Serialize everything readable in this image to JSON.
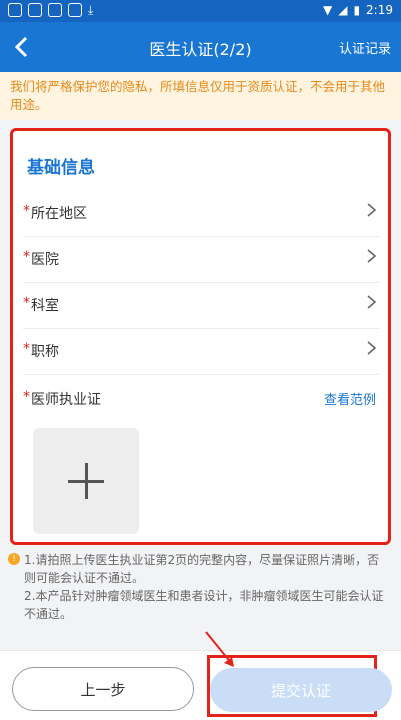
{
  "status_bar": {
    "time": "2:19"
  },
  "header": {
    "title": "医生认证(2/2)",
    "right_link": "认证记录"
  },
  "notice": {
    "text": "我们将严格保护您的隐私，所填信息仅用于资质认证，不会用于其他用途。"
  },
  "form": {
    "section_title": "基础信息",
    "required_mark": "*",
    "fields": [
      {
        "label": "所在地区"
      },
      {
        "label": "医院"
      },
      {
        "label": "科室"
      },
      {
        "label": "职称"
      }
    ],
    "license": {
      "label": "医师执业证",
      "example_link": "查看范例"
    }
  },
  "tips": {
    "line1": "1.请拍照上传医生执业证第2页的完整内容，尽量保证照片清晰，否则可能会认证不通过。",
    "line2": "2.本产品针对肿瘤领域医生和患者设计，非肿瘤领域医生可能会认证不通过。"
  },
  "footer": {
    "prev_label": "上一步",
    "submit_label": "提交认证"
  }
}
